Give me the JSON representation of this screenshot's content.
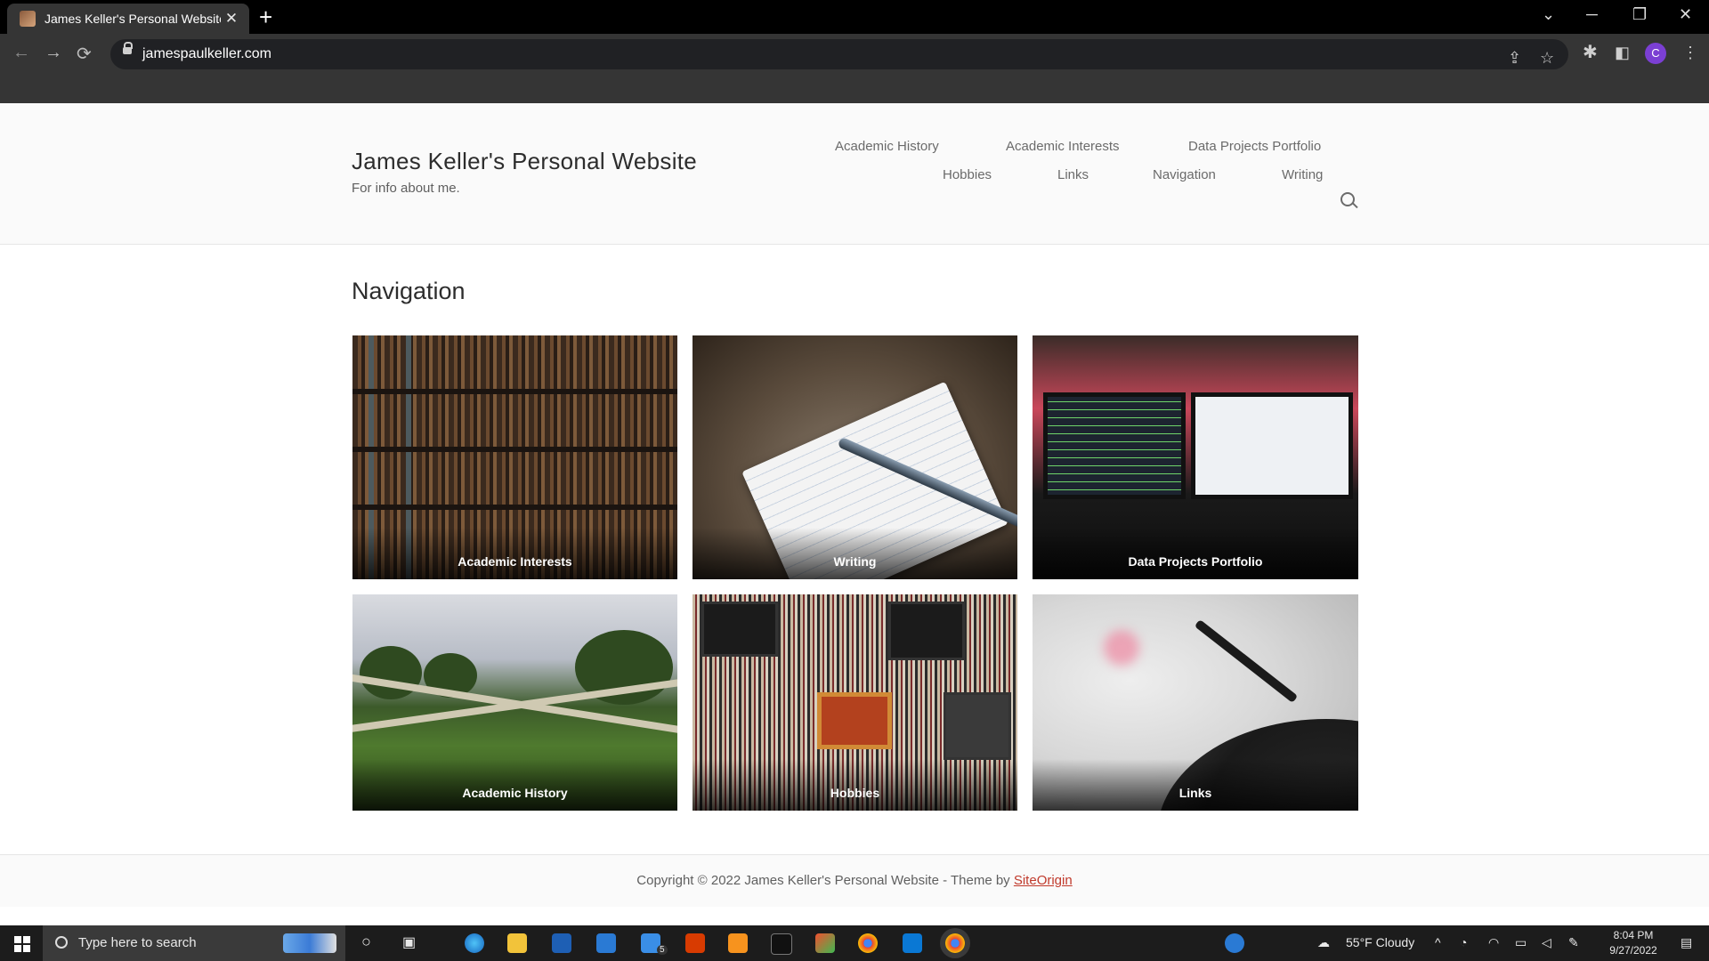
{
  "browser": {
    "tab_title": "James Keller's Personal Website",
    "tab_close": "✕",
    "new_tab": "+",
    "url": "jamespaulkeller.com",
    "profile_initial": "C",
    "window_controls": [
      "⌄",
      "─",
      "❐",
      "✕"
    ],
    "nav": {
      "back": "←",
      "forward": "→",
      "reload": "⟳"
    },
    "toolbar_icons": [
      "share-icon",
      "star-icon",
      "extensions-icon",
      "side-panel-icon",
      "menu-icon"
    ]
  },
  "site": {
    "title": "James Keller's Personal Website",
    "description": "For info about me.",
    "menu": [
      "Academic History",
      "Academic Interests",
      "Data Projects Portfolio",
      "Hobbies",
      "Links",
      "Navigation",
      "Writing"
    ]
  },
  "main": {
    "page_title": "Navigation",
    "cards": [
      "Academic Interests",
      "Writing",
      "Data Projects Portfolio",
      "Academic History",
      "Hobbies",
      "Links"
    ]
  },
  "footer": {
    "text": "Copyright © 2022 James Keller's Personal Website - Theme by ",
    "link": "SiteOrigin"
  },
  "taskbar": {
    "search_placeholder": "Type here to search",
    "mail_badge": "5",
    "weather": "55°F  Cloudy",
    "time": "8:04 PM",
    "date": "9/27/2022"
  }
}
